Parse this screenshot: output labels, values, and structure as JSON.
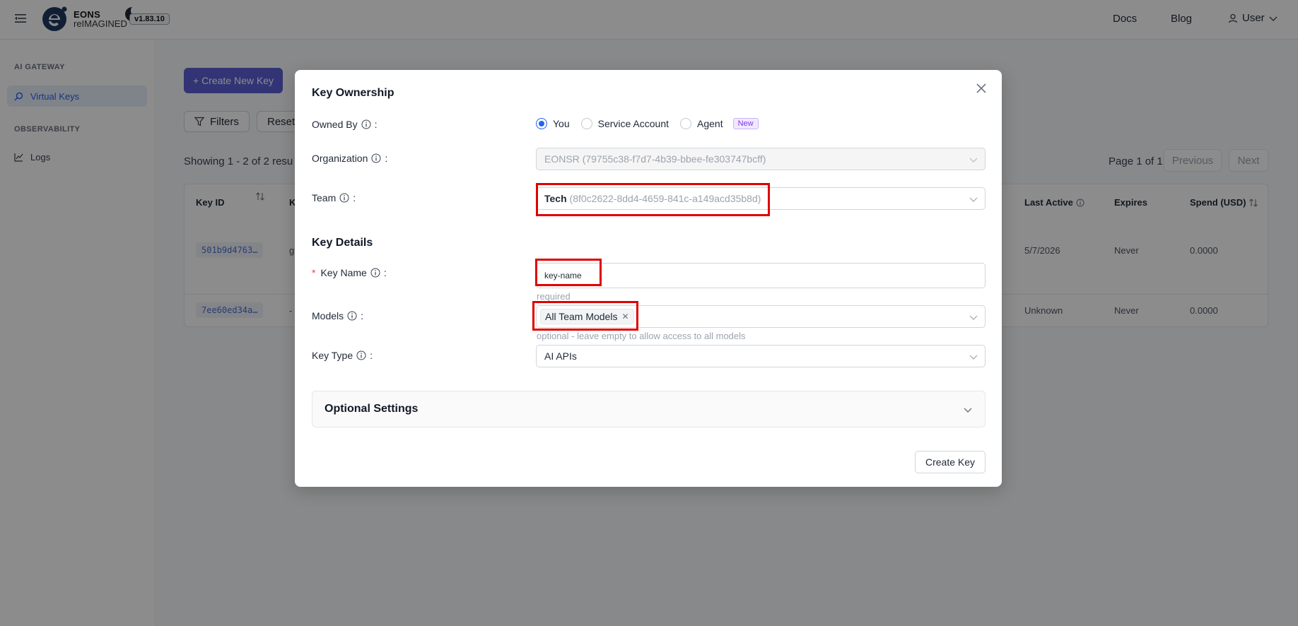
{
  "header": {
    "logo_line1": "EONS",
    "logo_line2": "reIMAGINED",
    "version": "v1.83.10",
    "nav": [
      "Docs",
      "Blog"
    ],
    "user_label": "User"
  },
  "sidebar": {
    "sections": [
      {
        "title": "AI GATEWAY",
        "items": [
          {
            "label": "Virtual Keys",
            "icon": "search-icon",
            "active": true
          }
        ]
      },
      {
        "title": "OBSERVABILITY",
        "items": [
          {
            "label": "Logs",
            "icon": "chart-line-icon",
            "active": false
          }
        ]
      }
    ]
  },
  "main": {
    "create_button": "+ Create New Key",
    "filters_button": "Filters",
    "reset_button": "Reset",
    "showing_text": "Showing 1 - 2 of 2 resu",
    "page_info": "Page 1 of 1",
    "previous_label": "Previous",
    "next_label": "Next",
    "table": {
      "headers": {
        "key_id": "Key ID",
        "k": "K",
        "last_active": "Last Active",
        "expires": "Expires",
        "spend": "Spend (USD)"
      },
      "rows": [
        {
          "key_id": "501b9d4763…",
          "k": "g",
          "last_active": "5/7/2026",
          "expires": "Never",
          "spend": "0.0000"
        },
        {
          "key_id": "7ee60ed34a…",
          "k": "-",
          "last_active": "Unknown",
          "expires": "Never",
          "spend": "0.0000"
        }
      ]
    }
  },
  "modal": {
    "title": "Key Ownership",
    "owned_by_label": "Owned By",
    "owned_by_options": [
      {
        "label": "You",
        "selected": true
      },
      {
        "label": "Service Account",
        "selected": false
      },
      {
        "label": "Agent",
        "selected": false,
        "badge": "New"
      }
    ],
    "organization_label": "Organization",
    "organization_name": "EONSR",
    "organization_id": "(79755c38-f7d7-4b39-bbee-fe303747bcff)",
    "team_label": "Team",
    "team_name": "Tech",
    "team_id": "(8f0c2622-8dd4-4659-841c-a149acd35b8d)",
    "key_details_title": "Key Details",
    "key_name_label": "Key Name",
    "key_name_value": "key-name",
    "key_name_help": "required",
    "models_label": "Models",
    "models_tag": "All Team Models",
    "models_help": "optional - leave empty to allow access to all models",
    "key_type_label": "Key Type",
    "key_type_value": "AI APIs",
    "optional_settings": "Optional Settings",
    "create_key_button": "Create Key"
  },
  "colors": {
    "primary_button": "#5b5fd6",
    "radio_selected": "#2563eb",
    "highlight": "#e00000",
    "required_star": "#ef4444"
  }
}
